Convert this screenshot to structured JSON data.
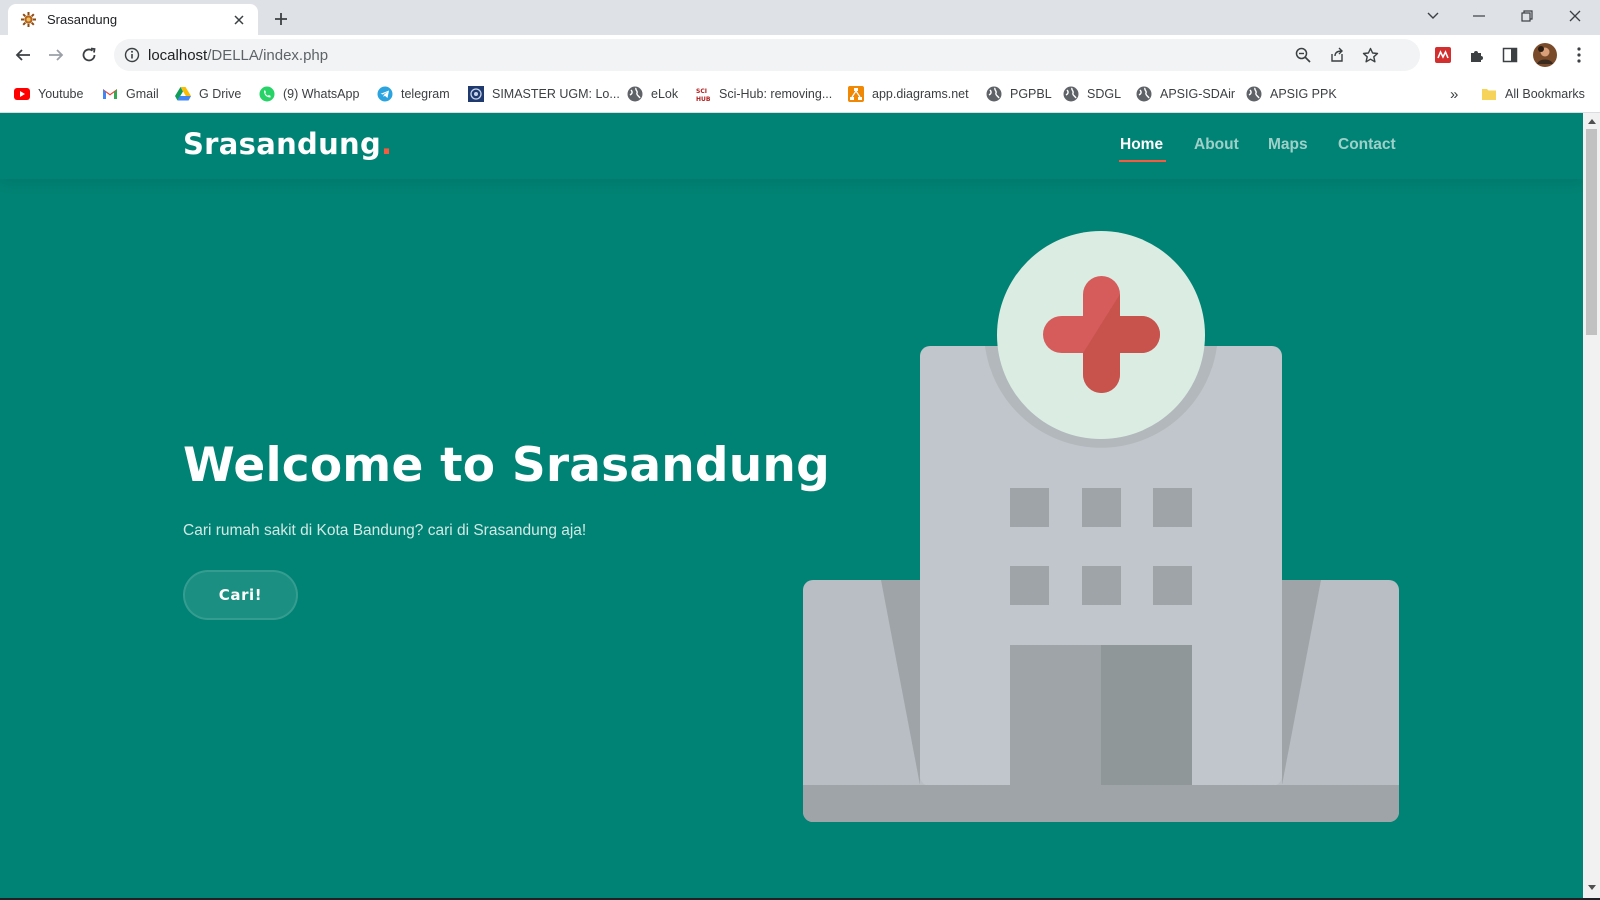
{
  "browser": {
    "tab": {
      "title": "Srasandung",
      "favicon": "gear-sun-icon"
    },
    "url": {
      "host": "localhost",
      "path": "/DELLA/index.php"
    },
    "bookmarks": [
      {
        "label": "Youtube",
        "icon": "youtube-icon"
      },
      {
        "label": "Gmail",
        "icon": "gmail-icon"
      },
      {
        "label": "G Drive",
        "icon": "google-drive-icon"
      },
      {
        "label": "(9) WhatsApp",
        "icon": "whatsapp-icon"
      },
      {
        "label": "telegram",
        "icon": "telegram-icon"
      },
      {
        "label": "SIMASTER UGM: Lo...",
        "icon": "simaster-icon"
      },
      {
        "label": "eLok",
        "icon": "globe-icon"
      },
      {
        "label": "Sci-Hub: removing...",
        "icon": "scihub-icon"
      },
      {
        "label": "app.diagrams.net",
        "icon": "diagrams-icon"
      },
      {
        "label": "PGPBL",
        "icon": "globe-icon"
      },
      {
        "label": "SDGL",
        "icon": "globe-icon"
      },
      {
        "label": "APSIG-SDAir",
        "icon": "globe-icon"
      },
      {
        "label": "APSIG PPK",
        "icon": "globe-icon"
      }
    ],
    "overflow_label": "»",
    "all_bookmarks_label": "All Bookmarks"
  },
  "site": {
    "logo": "Srasandung",
    "logo_dot": ".",
    "nav": [
      {
        "label": "Home",
        "active": true
      },
      {
        "label": "About",
        "active": false
      },
      {
        "label": "Maps",
        "active": false
      },
      {
        "label": "Contact",
        "active": false
      }
    ],
    "hero": {
      "title": "Welcome to Srasandung",
      "subtitle": "Cari rumah sakit di Kota Bandung? cari di Srasandung aja!",
      "button": "Cari!",
      "illustration": "hospital-building-illustration"
    }
  },
  "colors": {
    "brand": "#008374",
    "accent": "#f85a40",
    "cross": "#d65c5c"
  }
}
